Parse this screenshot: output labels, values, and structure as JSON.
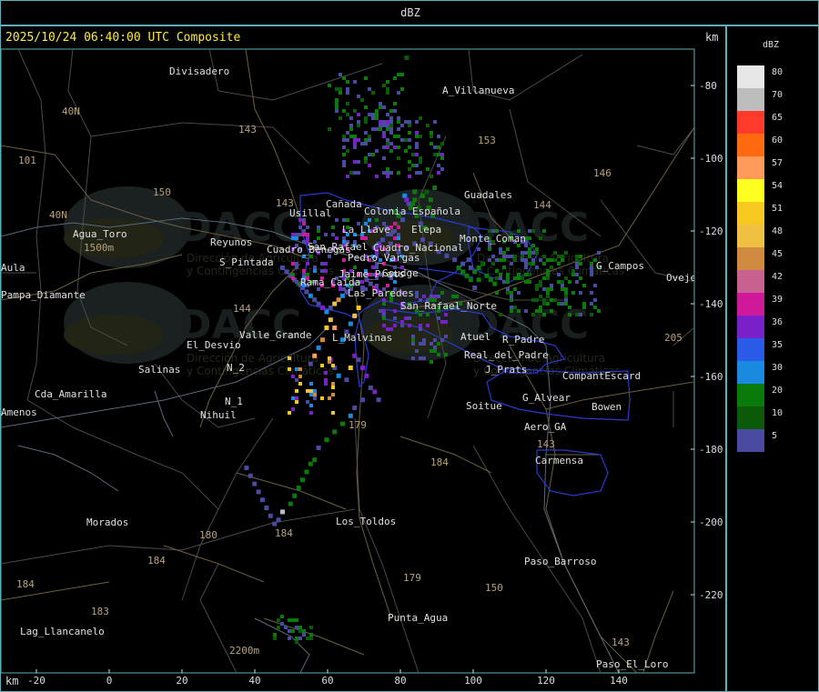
{
  "title": "dBZ",
  "timestamp": "2025/10/24 06:40:00 UTC Composite",
  "axis_unit": "km",
  "x_ticks": [
    "-20",
    "0",
    "20",
    "40",
    "60",
    "80",
    "100",
    "120",
    "140"
  ],
  "y_ticks": [
    "-80",
    "-100",
    "-120",
    "-140",
    "-160",
    "-180",
    "-200",
    "-220"
  ],
  "legend": {
    "unit": "dBZ",
    "entries": [
      {
        "label": "80",
        "color": "#e6e6e6"
      },
      {
        "label": "70",
        "color": "#bdbdbd"
      },
      {
        "label": "65",
        "color": "#ff3a2a"
      },
      {
        "label": "60",
        "color": "#ff6a10"
      },
      {
        "label": "57",
        "color": "#ff9a5a"
      },
      {
        "label": "54",
        "color": "#ffff20"
      },
      {
        "label": "51",
        "color": "#f6c820"
      },
      {
        "label": "48",
        "color": "#f0c040"
      },
      {
        "label": "45",
        "color": "#d08a40"
      },
      {
        "label": "42",
        "color": "#c86090"
      },
      {
        "label": "39",
        "color": "#d0189a"
      },
      {
        "label": "36",
        "color": "#7a20c8"
      },
      {
        "label": "35",
        "color": "#2a5ae8"
      },
      {
        "label": "30",
        "color": "#1a8ae0"
      },
      {
        "label": "20",
        "color": "#0a7a0a"
      },
      {
        "label": "10",
        "color": "#0a5a0a"
      },
      {
        "label": "5",
        "color": "#4a4aa0"
      }
    ]
  },
  "places": [
    {
      "name": "Divisadero"
    },
    {
      "name": "A_Villanueva"
    },
    {
      "name": "Guadales"
    },
    {
      "name": "Usillal"
    },
    {
      "name": "Cañada"
    },
    {
      "name": "Colonia Española"
    },
    {
      "name": "La_Llave"
    },
    {
      "name": "Elepa"
    },
    {
      "name": "Cuadro_Nacional"
    },
    {
      "name": "Pedro_Vargas"
    },
    {
      "name": "Jaime_Prats"
    },
    {
      "name": "Goudge"
    },
    {
      "name": "Rama_Caida"
    },
    {
      "name": "Las_Paredes"
    },
    {
      "name": "Cuadro_Benegas"
    },
    {
      "name": "San_Rafael"
    },
    {
      "name": "Monte_Coman"
    },
    {
      "name": "G_Campos"
    },
    {
      "name": "Oveje"
    },
    {
      "name": "Agua_Toro"
    },
    {
      "name": "Pampa_Diamante"
    },
    {
      "name": "Reyunos"
    },
    {
      "name": "S_Pintada"
    },
    {
      "name": "Valle_Grande"
    },
    {
      "name": "El_Desvio"
    },
    {
      "name": "L_Malvinas"
    },
    {
      "name": "Nihuil"
    },
    {
      "name": "N_2"
    },
    {
      "name": "N_1"
    },
    {
      "name": "Salinas"
    },
    {
      "name": "Cda_Amarilla"
    },
    {
      "name": "Amenos"
    },
    {
      "name": "Soitue"
    },
    {
      "name": "G_Alvear"
    },
    {
      "name": "Aero_GA"
    },
    {
      "name": "Bowen"
    },
    {
      "name": "CompantEscard"
    },
    {
      "name": "Carmensa"
    },
    {
      "name": "Los_Toldos"
    },
    {
      "name": "Morados"
    },
    {
      "name": "Paso_Barroso"
    },
    {
      "name": "Punta_Agua"
    },
    {
      "name": "Lag_Llancanelo"
    },
    {
      "name": "Paso_El_Loro"
    },
    {
      "name": "Atuel"
    },
    {
      "name": "R_Padre"
    },
    {
      "name": "J_Prats"
    },
    {
      "name": "Aula"
    },
    {
      "name": "Real_del_Padre"
    },
    {
      "name": "San_Rafael_Norte"
    }
  ],
  "routes": [
    "143",
    "153",
    "146",
    "150",
    "101",
    "40N",
    "40N",
    "144",
    "143",
    "144",
    "179",
    "184",
    "180",
    "184",
    "183",
    "184",
    "179",
    "150",
    "143",
    "143",
    "205"
  ],
  "watermark": {
    "brand": "DACC",
    "line1": "Dirección de Agricultura",
    "line2": "y Contingencias Climáticas"
  },
  "elevation_labels": [
    "1500m",
    "2200m"
  ],
  "reflectivity_cells": [
    [
      -1,
      -10,
      5
    ],
    [
      0,
      -12,
      5
    ],
    [
      2,
      -25,
      10
    ],
    [
      4,
      -100,
      20
    ],
    [
      5,
      -98,
      20
    ],
    [
      6,
      -96,
      20
    ],
    [
      8,
      -100,
      10
    ],
    [
      7,
      -104,
      20
    ],
    [
      6,
      -92,
      20
    ],
    [
      3,
      -98,
      5
    ],
    [
      10,
      -94,
      20
    ],
    [
      12,
      -92,
      10
    ],
    [
      14,
      -96,
      20
    ],
    [
      9,
      -108,
      5
    ],
    [
      11,
      -110,
      20
    ],
    [
      0,
      -106,
      5
    ],
    [
      -2,
      -104,
      20
    ],
    [
      -4,
      -102,
      20
    ],
    [
      -3,
      -108,
      10
    ],
    [
      13,
      -100,
      20
    ],
    [
      15,
      -104,
      20
    ],
    [
      16,
      -90,
      20
    ],
    [
      1,
      -94,
      30
    ],
    [
      2,
      -96,
      36
    ],
    [
      -5,
      -112,
      5
    ],
    [
      -8,
      -110,
      5
    ],
    [
      -10,
      -116,
      5
    ],
    [
      -12,
      -118,
      5
    ],
    [
      -14,
      -120,
      5
    ],
    [
      -6,
      -118,
      5
    ],
    [
      -2,
      -122,
      5
    ],
    [
      2,
      -120,
      5
    ],
    [
      6,
      -118,
      5
    ],
    [
      10,
      -116,
      5
    ],
    [
      14,
      -118,
      5
    ],
    [
      18,
      -122,
      5
    ],
    [
      22,
      -124,
      5
    ],
    [
      26,
      -126,
      5
    ],
    [
      30,
      -128,
      5
    ],
    [
      34,
      -130,
      5
    ],
    [
      28,
      -130,
      20
    ],
    [
      30,
      -132,
      20
    ],
    [
      32,
      -134,
      20
    ],
    [
      34,
      -136,
      20
    ],
    [
      36,
      -132,
      20
    ],
    [
      38,
      -130,
      20
    ],
    [
      40,
      -128,
      20
    ],
    [
      42,
      -134,
      20
    ],
    [
      44,
      -136,
      20
    ],
    [
      46,
      -138,
      20
    ],
    [
      38,
      -136,
      20
    ],
    [
      36,
      -140,
      5
    ],
    [
      33,
      -126,
      5
    ],
    [
      -18,
      -136,
      5
    ],
    [
      -16,
      -138,
      5
    ],
    [
      -14,
      -140,
      39
    ],
    [
      -12,
      -142,
      36
    ],
    [
      -20,
      -140,
      5
    ],
    [
      -24,
      -138,
      5
    ],
    [
      -26,
      -140,
      36
    ],
    [
      -28,
      -142,
      5
    ],
    [
      -30,
      -144,
      30
    ],
    [
      -32,
      -146,
      45
    ],
    [
      -34,
      -148,
      48
    ],
    [
      -36,
      -150,
      5
    ],
    [
      -38,
      -152,
      30
    ],
    [
      -40,
      -150,
      36
    ],
    [
      -42,
      -148,
      5
    ],
    [
      -44,
      -146,
      5
    ],
    [
      -46,
      -144,
      30
    ],
    [
      -48,
      -142,
      5
    ],
    [
      -50,
      -140,
      5
    ],
    [
      -52,
      -138,
      20
    ],
    [
      -54,
      -136,
      5
    ],
    [
      -56,
      -134,
      5
    ],
    [
      -58,
      -132,
      5
    ],
    [
      -60,
      -130,
      5
    ],
    [
      -22,
      -150,
      51
    ],
    [
      -24,
      -154,
      48
    ],
    [
      -26,
      -158,
      30
    ],
    [
      -28,
      -162,
      5
    ],
    [
      -30,
      -166,
      30
    ],
    [
      -34,
      -160,
      57
    ],
    [
      -36,
      -156,
      48
    ],
    [
      -38,
      -160,
      51
    ],
    [
      -40,
      -166,
      45
    ],
    [
      -42,
      -170,
      30
    ],
    [
      -44,
      -174,
      57
    ],
    [
      -46,
      -178,
      5
    ],
    [
      -36,
      -176,
      36
    ],
    [
      -34,
      -180,
      5
    ],
    [
      -32,
      -184,
      30
    ],
    [
      -28,
      -186,
      5
    ],
    [
      -26,
      -180,
      51
    ],
    [
      -24,
      -174,
      36
    ],
    [
      -22,
      -176,
      5
    ],
    [
      -20,
      -180,
      36
    ],
    [
      -18,
      -184,
      36
    ],
    [
      -16,
      -190,
      5
    ],
    [
      -14,
      -192,
      36
    ],
    [
      -12,
      -196,
      5
    ],
    [
      -20,
      -196,
      5
    ],
    [
      -24,
      -200,
      5
    ],
    [
      -26,
      -204,
      30
    ],
    [
      -30,
      -208,
      20
    ],
    [
      -34,
      -212,
      20
    ],
    [
      -38,
      -216,
      20
    ],
    [
      -42,
      -220,
      5
    ],
    [
      -44,
      -226,
      20
    ],
    [
      -46,
      -228,
      20
    ],
    [
      -48,
      -232,
      20
    ],
    [
      -50,
      -236,
      20
    ],
    [
      -52,
      -240,
      20
    ],
    [
      -54,
      -244,
      20
    ],
    [
      -56,
      -248,
      20
    ],
    [
      -60,
      -252,
      70
    ],
    [
      -62,
      -256,
      5
    ],
    [
      -64,
      -258,
      5
    ],
    [
      -66,
      -254,
      5
    ],
    [
      -68,
      -250,
      5
    ],
    [
      -70,
      -246,
      5
    ],
    [
      -72,
      -242,
      5
    ],
    [
      -74,
      -238,
      5
    ],
    [
      -76,
      -234,
      5
    ],
    [
      -78,
      -230,
      5
    ]
  ]
}
